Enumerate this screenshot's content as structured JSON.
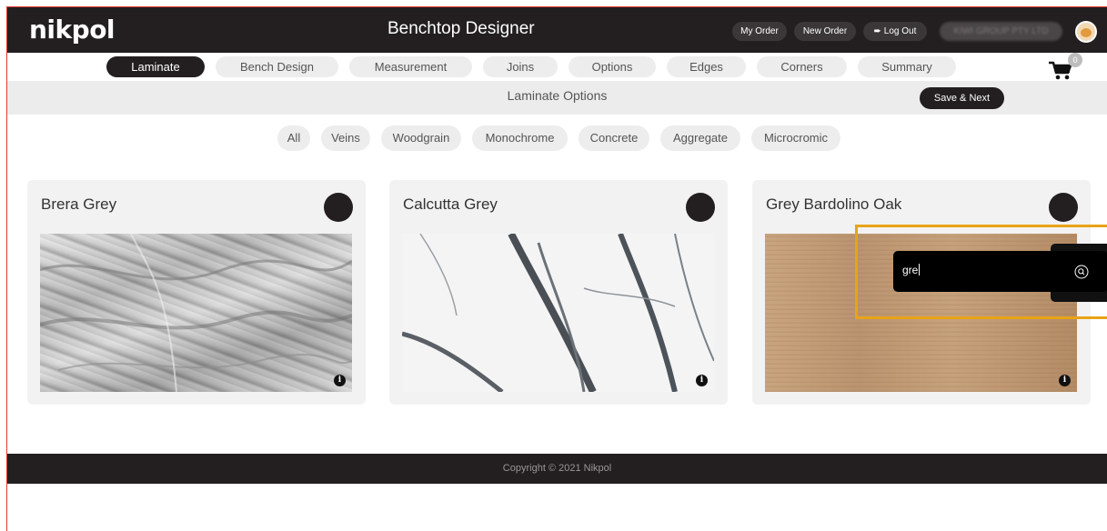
{
  "header": {
    "logo": "nikpol",
    "title": "Benchtop Designer",
    "my_order": "My Order",
    "new_order": "New Order",
    "log_out": "Log Out",
    "account_name": "KIWI GROUP PTY LTD"
  },
  "tabs": [
    {
      "label": "Laminate",
      "active": true
    },
    {
      "label": "Bench Design",
      "active": false
    },
    {
      "label": "Measurement",
      "active": false
    },
    {
      "label": "Joins",
      "active": false
    },
    {
      "label": "Options",
      "active": false
    },
    {
      "label": "Edges",
      "active": false
    },
    {
      "label": "Corners",
      "active": false
    },
    {
      "label": "Summary",
      "active": false
    }
  ],
  "cart": {
    "count": "0",
    "icon": "cart-icon"
  },
  "section": {
    "title": "Laminate Options",
    "save_next": "Save & Next"
  },
  "filters": [
    "All",
    "Veins",
    "Woodgrain",
    "Monochrome",
    "Concrete",
    "Aggregate",
    "Microcromic"
  ],
  "products": [
    {
      "name": "Brera Grey"
    },
    {
      "name": "Calcutta Grey"
    },
    {
      "name": "Grey Bardolino Oak"
    }
  ],
  "search": {
    "value": "gre"
  },
  "footer": {
    "copyright": "Copyright © 2021 Nikpol"
  },
  "colors": {
    "dark": "#231f20",
    "highlight": "#e8a317",
    "pill": "#ededed"
  }
}
